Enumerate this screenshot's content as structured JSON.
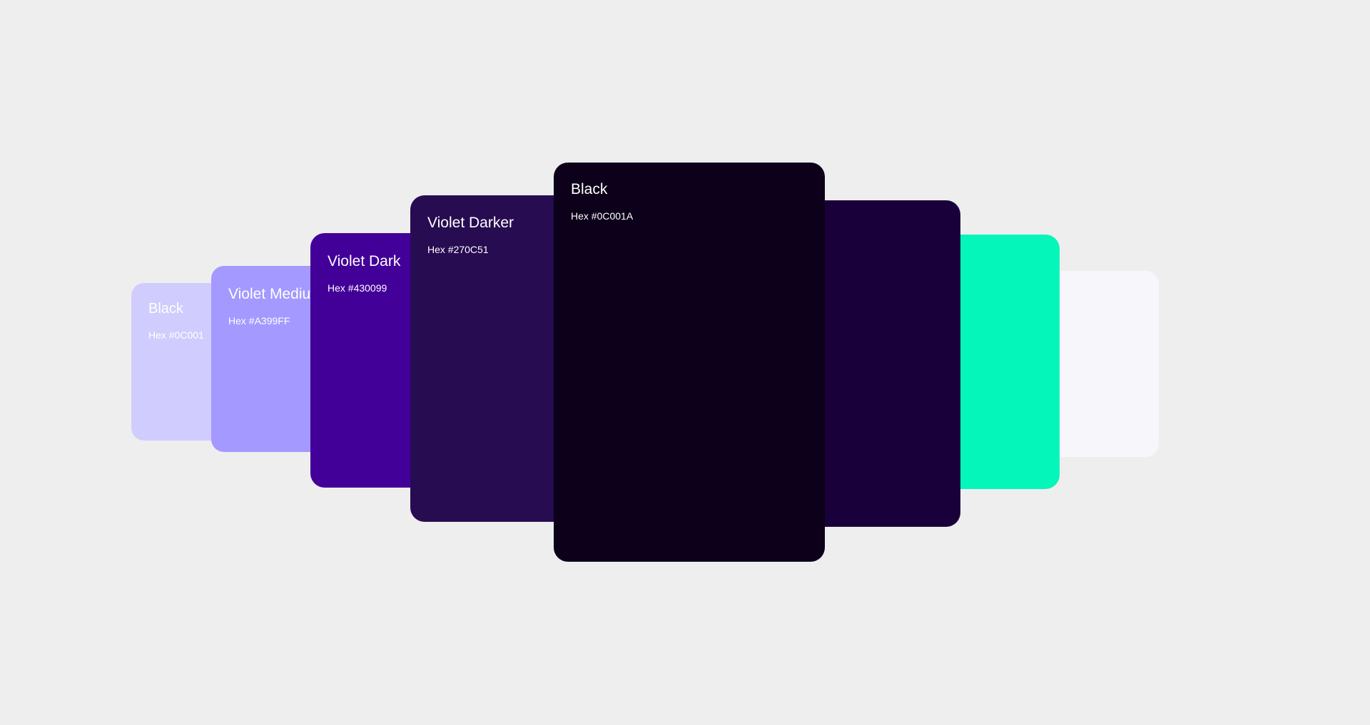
{
  "swatches": [
    {
      "name": "Black",
      "hex_label": "Hex #0C001",
      "color": "#D0CCFD",
      "text_color": "#FFFFFF"
    },
    {
      "name": "Violet Medium",
      "hex_label": "Hex #A399FF",
      "color": "#A399FF",
      "text_color": "#FFFFFF"
    },
    {
      "name": "Violet Dark",
      "hex_label": "Hex #430099",
      "color": "#430099",
      "text_color": "#FFFFFF"
    },
    {
      "name": "Violet Darker",
      "hex_label": "Hex #270C51",
      "color": "#270C51",
      "text_color": "#FFFFFF"
    },
    {
      "name": "Black",
      "hex_label": "Hex #0C001A",
      "color": "#0C001A",
      "text_color": "#FFFFFF"
    },
    {
      "name": "",
      "hex_label": "",
      "color": "#19003A",
      "text_color": "#FFFFFF"
    },
    {
      "name": "",
      "hex_label": "",
      "color": "#05F6BA",
      "text_color": "#FFFFFF"
    },
    {
      "name": "",
      "hex_label": "",
      "color": "#F7F7FB",
      "text_color": "#FFFFFF"
    }
  ],
  "background": "#EEEEEE"
}
